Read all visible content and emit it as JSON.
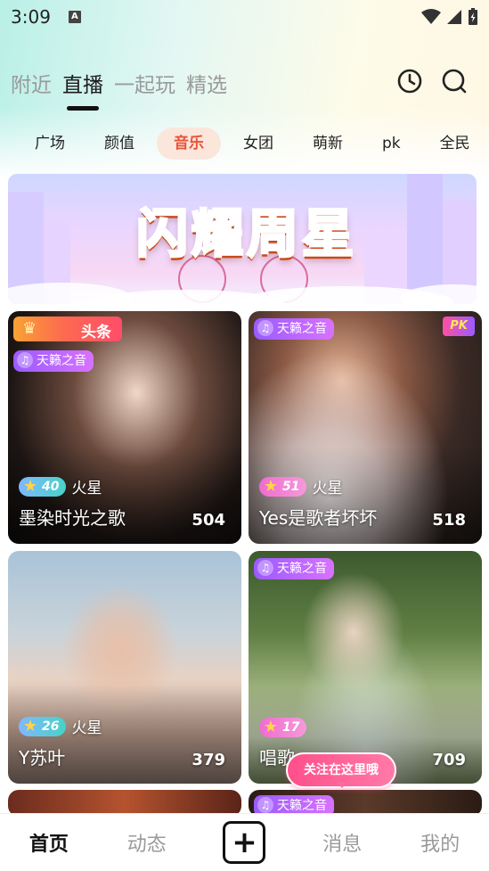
{
  "status_bar": {
    "time": "3:09",
    "notification_icon": "A"
  },
  "main_tabs": [
    {
      "label": "附近",
      "active": false
    },
    {
      "label": "直播",
      "active": true
    },
    {
      "label": "一起玩",
      "active": false
    },
    {
      "label": "精选",
      "active": false
    }
  ],
  "header_icons": [
    "history-clock-icon",
    "search-icon"
  ],
  "categories": [
    {
      "label": "广场",
      "active": false
    },
    {
      "label": "颜值",
      "active": false
    },
    {
      "label": "音乐",
      "active": true
    },
    {
      "label": "女团",
      "active": false
    },
    {
      "label": "萌新",
      "active": false
    },
    {
      "label": "pk",
      "active": false
    },
    {
      "label": "全民",
      "active": false
    }
  ],
  "banner": {
    "title": "闪耀周星"
  },
  "cards": [
    {
      "title": "墨染时光之歌",
      "viewers": "504",
      "level": "40",
      "level_label": "火星",
      "tag": "天籁之音",
      "headline_tag": "头条",
      "badge_color": "teal"
    },
    {
      "title": "Yes是歌者坏坏",
      "viewers": "518",
      "level": "51",
      "level_label": "火星",
      "tag": "天籁之音",
      "pk_badge": "PK",
      "badge_color": "pink"
    },
    {
      "title": "Y苏叶",
      "viewers": "379",
      "level": "26",
      "level_label": "火星",
      "badge_color": "teal"
    },
    {
      "title": "唱歌",
      "viewers": "709",
      "level": "17",
      "level_label": "",
      "tag": "天籁之音",
      "badge_color": "pink"
    }
  ],
  "bottom_tags": [
    "天籁之音"
  ],
  "follow_bubble": "关注在这里哦",
  "bottom_nav": [
    {
      "label": "首页",
      "active": true
    },
    {
      "label": "动态",
      "active": false
    },
    {
      "label": "+",
      "active": false
    },
    {
      "label": "消息",
      "active": false
    },
    {
      "label": "我的",
      "active": false
    }
  ],
  "colors": {
    "accent": "#e8543a",
    "active_cat_bg": "#fbe6dc",
    "tag_purple": "#9a5bff"
  }
}
